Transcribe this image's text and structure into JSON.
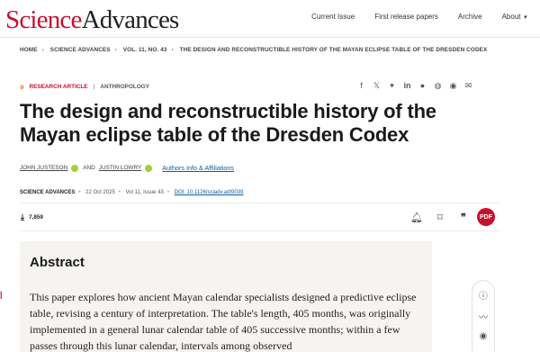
{
  "header": {
    "logo_first": "Science",
    "logo_second": "Advances",
    "nav": [
      "Current Issue",
      "First release papers",
      "Archive",
      "About"
    ]
  },
  "breadcrumb": [
    "HOME",
    "SCIENCE ADVANCES",
    "VOL. 11, NO. 43",
    "THE DESIGN AND RECONSTRUCTIBLE HISTORY OF THE MAYAN ECLIPSE TABLE OF THE DRESDEN CODEX"
  ],
  "article": {
    "type": "RESEARCH ARTICLE",
    "subject": "ANTHROPOLOGY",
    "title": "The design and reconstructible history of the Mayan eclipse table of the Dresden Codex",
    "authors": [
      "JOHN JUSTESON",
      "JUSTIN LOWRY"
    ],
    "author_joiner": "AND",
    "affiliations_link": "Authors Info & Affiliations",
    "journal": "SCIENCE ADVANCES",
    "date": "22 Oct 2025",
    "volume_issue": "Vol 11, Issue 43",
    "doi": "DOI: 10.1126/sciadv.adt9039",
    "downloads": "7,859",
    "pdf_label": "PDF"
  },
  "share_icons": [
    "facebook-icon",
    "x-icon",
    "bluesky-icon",
    "linkedin-icon",
    "reddit-icon",
    "wechat-icon",
    "chat-icon",
    "email-icon"
  ],
  "abstract": {
    "heading": "Abstract",
    "text": "This paper explores how ancient Mayan calendar specialists designed a predictive eclipse table, revising a century of interpretation. The table's length, 405 months, was originally implemented in a general lunar calendar table of 405 successive months; within a few passes through this lunar calendar, intervals among observed"
  },
  "colors": {
    "accent": "#c8102e",
    "link": "#0b5ea8",
    "orcid": "#a6ce39",
    "open_access": "#e87722"
  }
}
